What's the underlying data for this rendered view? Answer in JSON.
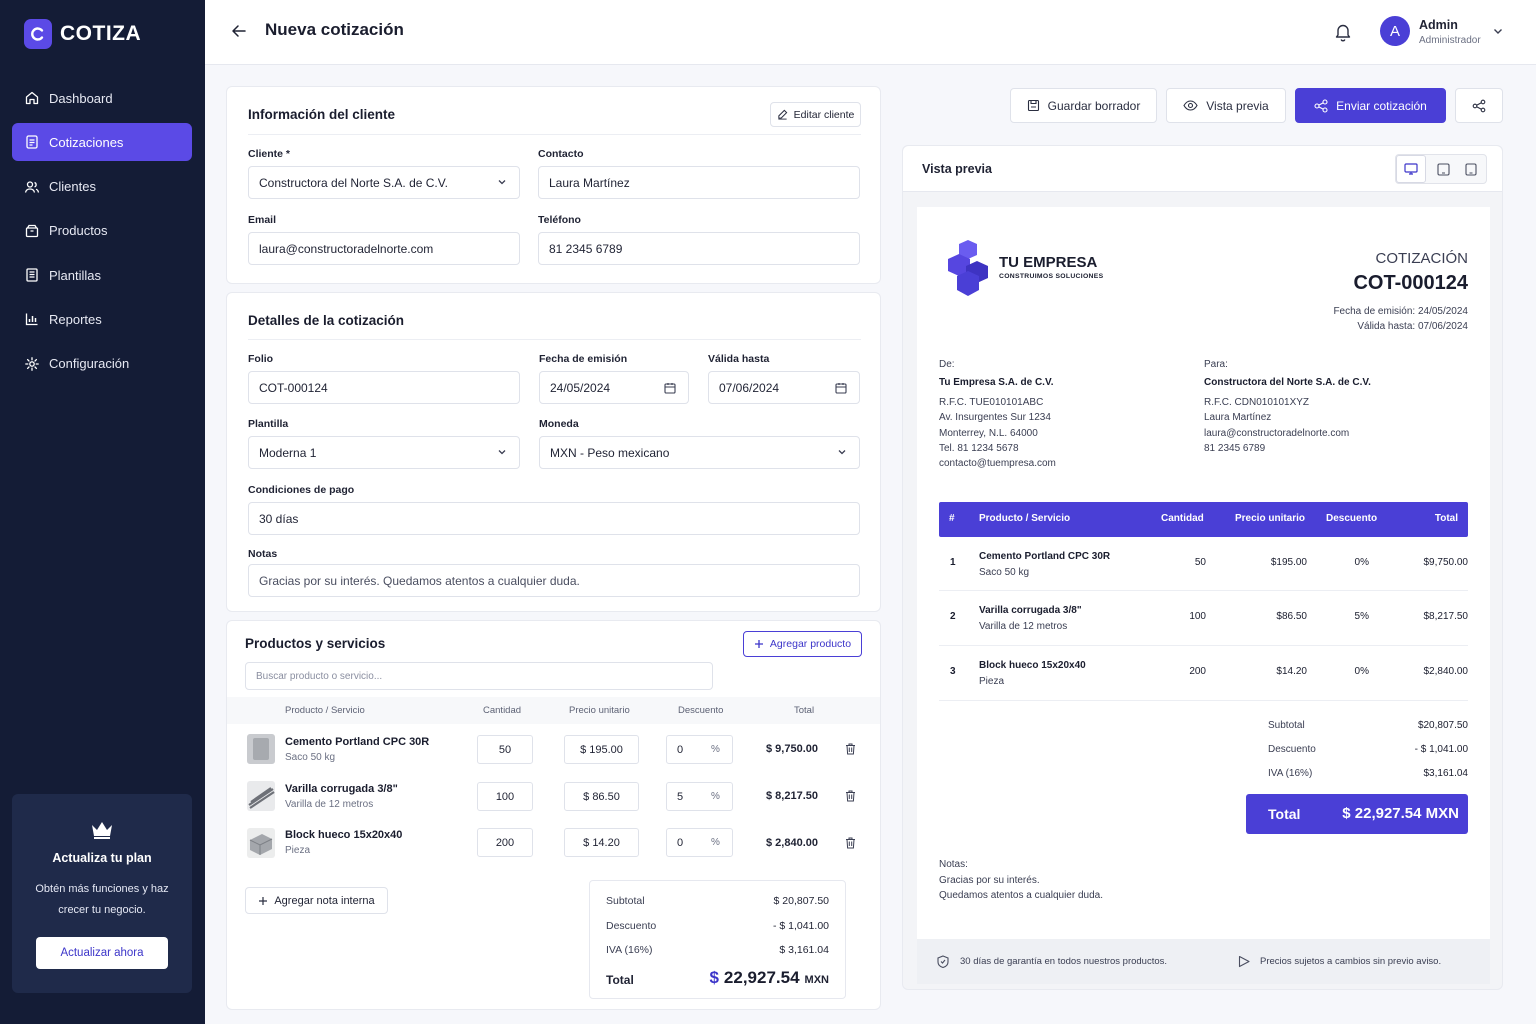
{
  "app": {
    "name": "COTIZA"
  },
  "sidebar": {
    "items": [
      {
        "label": "Dashboard"
      },
      {
        "label": "Cotizaciones"
      },
      {
        "label": "Clientes"
      },
      {
        "label": "Productos"
      },
      {
        "label": "Plantillas"
      },
      {
        "label": "Reportes"
      },
      {
        "label": "Configuración"
      }
    ],
    "upgrade": {
      "title": "Actualiza tu plan",
      "text": "Obtén más funciones y haz crecer tu negocio.",
      "button": "Actualizar ahora"
    }
  },
  "header": {
    "title": "Nueva cotización",
    "user_initial": "A",
    "user_name": "Admin",
    "user_role": "Administrador"
  },
  "client_info": {
    "title": "Información del cliente",
    "edit_button": "Editar cliente",
    "client_label": "Cliente *",
    "client_value": "Constructora del Norte S.A. de C.V.",
    "contact_label": "Contacto",
    "contact_value": "Laura Martínez",
    "email_label": "Email",
    "email_value": "laura@constructoradelnorte.com",
    "phone_label": "Teléfono",
    "phone_value": "81 2345 6789"
  },
  "details": {
    "title": "Detalles de la cotización",
    "folio_label": "Folio",
    "folio_value": "COT-000124",
    "issue_label": "Fecha de emisión",
    "issue_value": "24/05/2024",
    "valid_label": "Válida hasta",
    "valid_value": "07/06/2024",
    "template_label": "Plantilla",
    "template_value": "Moderna 1",
    "currency_label": "Moneda",
    "currency_value": "MXN - Peso mexicano",
    "terms_label": "Condiciones de pago",
    "terms_value": "30 días",
    "notes_label": "Notas",
    "notes_value": "Gracias por su interés. Quedamos atentos a cualquier duda."
  },
  "products": {
    "title": "Productos y servicios",
    "add_button": "Agregar producto",
    "search_placeholder": "Buscar producto o servicio...",
    "columns": [
      "Producto / Servicio",
      "Cantidad",
      "Precio unitario",
      "Descuento",
      "Total"
    ],
    "rows": [
      {
        "name": "Cemento Portland CPC 30R",
        "sub": "Saco 50 kg",
        "qty": "50",
        "price": "$ 195.00",
        "discount": "0",
        "pct": "%",
        "total": "$ 9,750.00"
      },
      {
        "name": "Varilla corrugada 3/8\"",
        "sub": "Varilla de 12 metros",
        "qty": "100",
        "price": "$ 86.50",
        "discount": "5",
        "pct": "%",
        "total": "$ 8,217.50"
      },
      {
        "name": "Block hueco 15x20x40",
        "sub": "Pieza",
        "qty": "200",
        "price": "$ 14.20",
        "discount": "0",
        "pct": "%",
        "total": "$ 2,840.00"
      }
    ],
    "note_button": "Agregar nota interna",
    "summary": {
      "subtotal_label": "Subtotal",
      "subtotal": "$ 20,807.50",
      "discount_label": "Descuento",
      "discount": "- $ 1,041.00",
      "iva_label": "IVA (16%)",
      "iva": "$ 3,161.04",
      "total_label": "Total",
      "total_symbol": "$",
      "total_amount": "22,927.54",
      "total_currency": "MXN"
    }
  },
  "actions": {
    "draft": "Guardar borrador",
    "preview": "Vista previa",
    "send": "Enviar cotización"
  },
  "preview": {
    "title": "Vista previa",
    "company": "TU EMPRESA",
    "tagline": "CONSTRUIMOS SOLUCIONES",
    "doc_type": "COTIZACIÓN",
    "doc_number": "COT-000124",
    "issue": "Fecha de emisión: 24/05/2024",
    "valid": "Válida hasta: 07/06/2024",
    "from_label": "De:",
    "from_name": "Tu Empresa S.A. de C.V.",
    "from_lines": [
      "R.F.C. TUE010101ABC",
      "Av. Insurgentes Sur 1234",
      "Monterrey, N.L. 64000",
      "Tel. 81 1234 5678",
      "contacto@tuempresa.com"
    ],
    "to_label": "Para:",
    "to_name": "Constructora del Norte S.A. de C.V.",
    "to_lines": [
      "R.F.C. CDN010101XYZ",
      "Laura Martínez",
      "laura@constructoradelnorte.com",
      "81 2345 6789"
    ],
    "columns": [
      "#",
      "Producto / Servicio",
      "Cantidad",
      "Precio unitario",
      "Descuento",
      "Total"
    ],
    "rows": [
      {
        "n": "1",
        "name": "Cemento Portland CPC 30R",
        "sub": "Saco 50 kg",
        "qty": "50",
        "price": "$195.00",
        "disc": "0%",
        "total": "$9,750.00"
      },
      {
        "n": "2",
        "name": "Varilla corrugada 3/8\"",
        "sub": "Varilla de 12 metros",
        "qty": "100",
        "price": "$86.50",
        "disc": "5%",
        "total": "$8,217.50"
      },
      {
        "n": "3",
        "name": "Block hueco 15x20x40",
        "sub": "Pieza",
        "qty": "200",
        "price": "$14.20",
        "disc": "0%",
        "total": "$2,840.00"
      }
    ],
    "subtotal_label": "Subtotal",
    "subtotal": "$20,807.50",
    "discount_label": "Descuento",
    "discount": "- $ 1,041.00",
    "iva_label": "IVA (16%)",
    "iva": "$3,161.04",
    "total_label": "Total",
    "total": "$ 22,927.54 MXN",
    "notes_label": "Notas:",
    "notes_lines": [
      "Gracias por su interés.",
      "Quedamos atentos a cualquier duda."
    ],
    "footer_1": "30 días de garantía en todos nuestros productos.",
    "footer_2": "Precios sujetos a cambios sin previo aviso."
  },
  "colors": {
    "accent": "#4a3fd6",
    "sidebar": "#141c36",
    "sidebar_active": "#5b4ae6"
  }
}
